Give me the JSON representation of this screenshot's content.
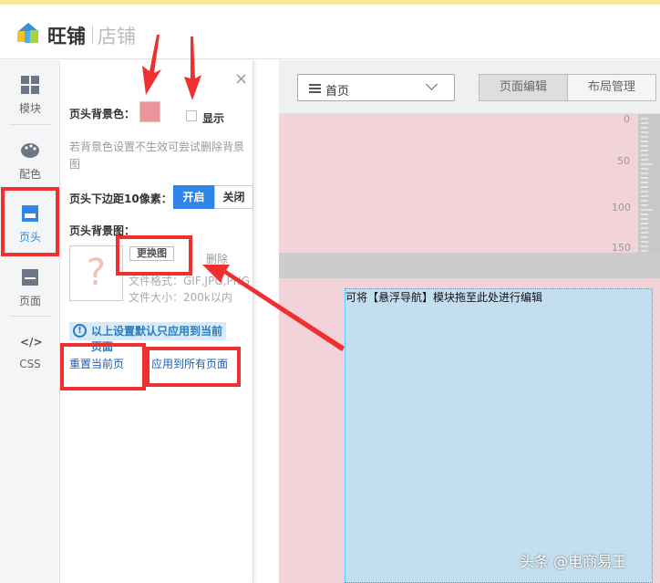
{
  "header": {
    "brand": "旺铺",
    "brand_sub": "店铺"
  },
  "nav": {
    "items": [
      {
        "label": "模块",
        "icon": "grid-icon"
      },
      {
        "label": "配色",
        "icon": "palette-icon"
      },
      {
        "label": "页头",
        "icon": "header-icon",
        "active": true
      },
      {
        "label": "页面",
        "icon": "page-icon"
      },
      {
        "label": "CSS",
        "icon": "code-icon"
      }
    ]
  },
  "panel": {
    "close": "×",
    "bg_color_label": "页头背景色：",
    "bg_color": "#e8969c",
    "show_label": "显示",
    "hint": "若背景色设置不生效可尝试删除背景图",
    "margin_label": "页头下边距10像素：",
    "on_label": "开启",
    "off_label": "关闭",
    "bg_image_label": "页头背景图：",
    "placeholder": "?",
    "replace_label": "更换图",
    "delete_label": "删除",
    "format": "文件格式：GIF,JPG,PNG",
    "size": "文件大小：200k以内",
    "notice": "以上设置默认只应用到当前页面",
    "reset_label": "重置当前页",
    "apply_all_label": "应用到所有页面"
  },
  "toolbar": {
    "page": "首页",
    "tab_edit": "页面编辑",
    "tab_layout": "布局管理"
  },
  "ruler": {
    "labels": [
      "0",
      "50",
      "100",
      "150"
    ]
  },
  "canvas": {
    "dropzone_text": "可将【悬浮导航】模块拖至此处进行编辑"
  },
  "watermark": "头条 @电商易王",
  "colors": {
    "accent": "#2f86e8",
    "header_bg": "#f2d3d9",
    "annotation": "#f03030"
  }
}
